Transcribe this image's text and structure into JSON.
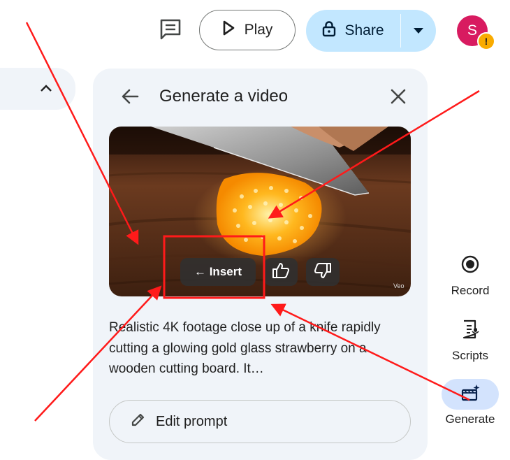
{
  "topbar": {
    "play_label": "Play",
    "share_label": "Share",
    "avatar_initial": "S",
    "warning_glyph": "!",
    "icons": [
      "comment-icon",
      "play-icon",
      "lock-icon",
      "chevron-down-icon"
    ]
  },
  "panel": {
    "title": "Generate a video",
    "icons": [
      "back-arrow-icon",
      "close-icon"
    ],
    "video": {
      "insert_label": "← Insert",
      "watermark": "Veo",
      "icons": [
        "thumbs-up-icon",
        "thumbs-down-icon"
      ]
    },
    "description": "Realistic 4K footage close up of a knife rapidly cutting a glowing gold glass strawberry on a wooden cutting board. It…",
    "edit_prompt_label": "Edit prompt"
  },
  "rail": {
    "items": [
      {
        "label": "Record",
        "icon": "record-icon"
      },
      {
        "label": "Scripts",
        "icon": "scripts-icon"
      },
      {
        "label": "Generate",
        "icon": "generate-video-icon",
        "active": true
      }
    ]
  },
  "colors": {
    "panel_bg": "#f0f4f9",
    "share_bg": "#c2e7ff",
    "active_rail": "#d3e3fd",
    "avatar": "#d81b60",
    "warning": "#f9ab00",
    "annotation": "#ff1a1a"
  }
}
